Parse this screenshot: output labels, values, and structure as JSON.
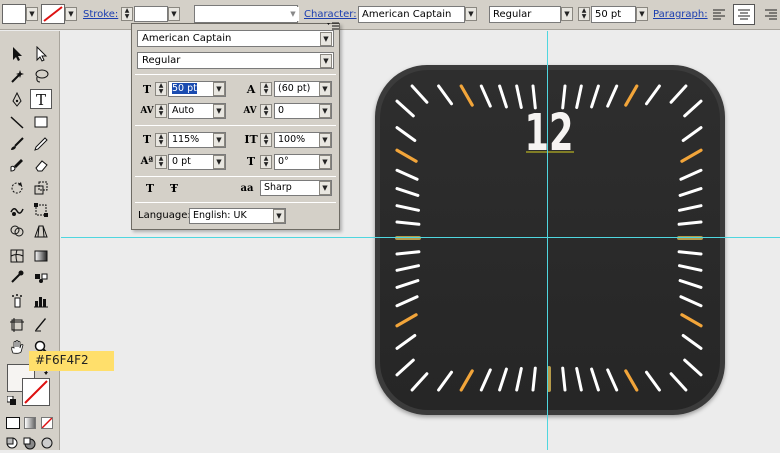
{
  "control_bar": {
    "stroke_label": "Stroke:",
    "character_label": "Character:",
    "font_family": "American Captain",
    "font_style": "Regular",
    "font_size": "50 pt",
    "paragraph_label": "Paragraph:"
  },
  "character_panel": {
    "menu_icon": "panel-menu-icon",
    "font_family": "American Captain",
    "font_style": "Regular",
    "font_size": "50 pt",
    "leading": "(60 pt)",
    "kerning": "Auto",
    "tracking": "0",
    "vertical_scale": "115%",
    "horizontal_scale": "100%",
    "baseline_shift": "0 pt",
    "rotation": "0°",
    "antialiasing": "Sharp",
    "language_label": "Language:",
    "language": "English: UK"
  },
  "tooltip": {
    "color_hex": "#F6F4F2"
  },
  "clock": {
    "label": "12",
    "colors": {
      "body": "#2b2b2b",
      "bezel": "#3a3a3a",
      "tick_white": "#ffffff",
      "tick_orange": "#f2a53a",
      "number": "#f6f4f2"
    }
  },
  "colors": {
    "guide": "#4fd6df",
    "panel_bg": "#d4d0c8",
    "canvas_bg": "#ececec"
  }
}
